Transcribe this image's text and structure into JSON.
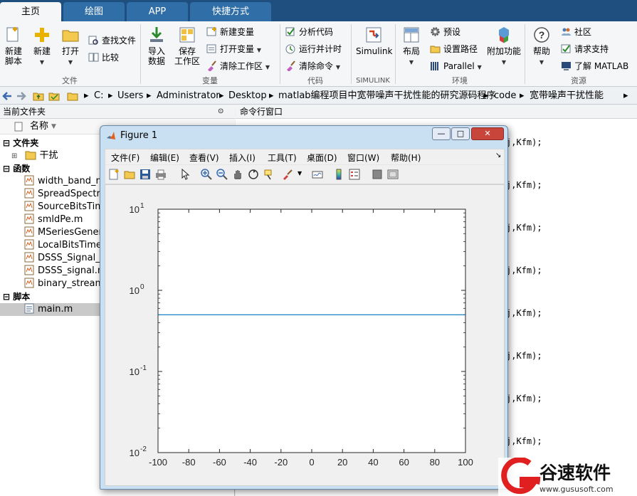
{
  "tabs": [
    {
      "label": "主页",
      "active": true
    },
    {
      "label": "绘图",
      "active": false
    },
    {
      "label": "APP",
      "active": false
    },
    {
      "label": "快捷方式",
      "active": false
    }
  ],
  "ribbon": {
    "new_script": "新建\n脚本",
    "new": "新建",
    "open": "打开",
    "find_files": "查找文件",
    "compare": "比较",
    "group_file": "文件",
    "import_data": "导入\n数据",
    "save_workspace": "保存\n工作区",
    "new_variable": "新建变量",
    "open_variable": "打开变量",
    "clear_workspace": "清除工作区",
    "group_variable": "变量",
    "analyze_code": "分析代码",
    "run_and_time": "运行并计时",
    "clear_commands": "清除命令",
    "group_code": "代码",
    "simulink": "Simulink",
    "group_simulink": "SIMULINK",
    "layout": "布局",
    "preferences": "预设",
    "set_path": "设置路径",
    "parallel": "Parallel",
    "group_environment": "环境",
    "add_ons": "附加功能",
    "help": "帮助",
    "community": "社区",
    "request_support": "请求支持",
    "learn_matlab": "了解 MATLAB",
    "group_resources": "资源"
  },
  "address": {
    "segments": [
      "C:",
      "Users",
      "Administrator",
      "Desktop",
      "matlab编程项目中宽带噪声干扰性能的研究源码程序",
      "code",
      "宽带噪声干扰性能"
    ]
  },
  "left_panel": {
    "title": "当前文件夹",
    "name_header": "名称",
    "sections": {
      "folders": "文件夹",
      "functions": "函数",
      "scripts": "脚本"
    },
    "folder_items": [
      "干扰"
    ],
    "function_items": [
      "width_band_no",
      "SpreadSpectru",
      "SourceBitsTime",
      "smldPe.m",
      "MSeriesGenera",
      "LocalBitsTimeS",
      "DSSS_Signal_D",
      "DSSS_signal.m",
      "binary_stream_"
    ],
    "script_items": [
      "main.m"
    ]
  },
  "command_window": {
    "title": "命令行窗口",
    "lines": [
      "j,Kfm);",
      "j,Kfm);",
      "j,Kfm);",
      "j,Kfm);",
      "j,Kfm);",
      "j,Kfm);",
      "j,Kfm);",
      "j,Kfm);"
    ]
  },
  "figure": {
    "title": "Figure 1",
    "menu": [
      "文件(F)",
      "编辑(E)",
      "查看(V)",
      "插入(I)",
      "工具(T)",
      "桌面(D)",
      "窗口(W)",
      "帮助(H)"
    ]
  },
  "chart_data": {
    "type": "line",
    "xlim": [
      -100,
      100
    ],
    "ylim": [
      0.01,
      10
    ],
    "yscale": "log",
    "x_ticks": [
      -100,
      -80,
      -60,
      -40,
      -20,
      0,
      20,
      40,
      60,
      80,
      100
    ],
    "y_ticks": [
      {
        "base": "10",
        "exp": "1",
        "value": 10
      },
      {
        "base": "10",
        "exp": "0",
        "value": 1
      },
      {
        "base": "10",
        "exp": "-1",
        "value": 0.1
      },
      {
        "base": "10",
        "exp": "-2",
        "value": 0.01
      }
    ],
    "series": [
      {
        "x": [
          -100,
          100
        ],
        "y": [
          0.5,
          0.5
        ],
        "color": "#0072bd"
      }
    ],
    "grid": false
  },
  "watermark": {
    "brand": "谷速软件",
    "url": "www.gususoft.com"
  },
  "colors": {
    "tabbar": "#1e4f7e",
    "tab_inactive": "#2f6ea6",
    "plot_line": "#0072bd",
    "selected_row": "#c9c9c9"
  }
}
